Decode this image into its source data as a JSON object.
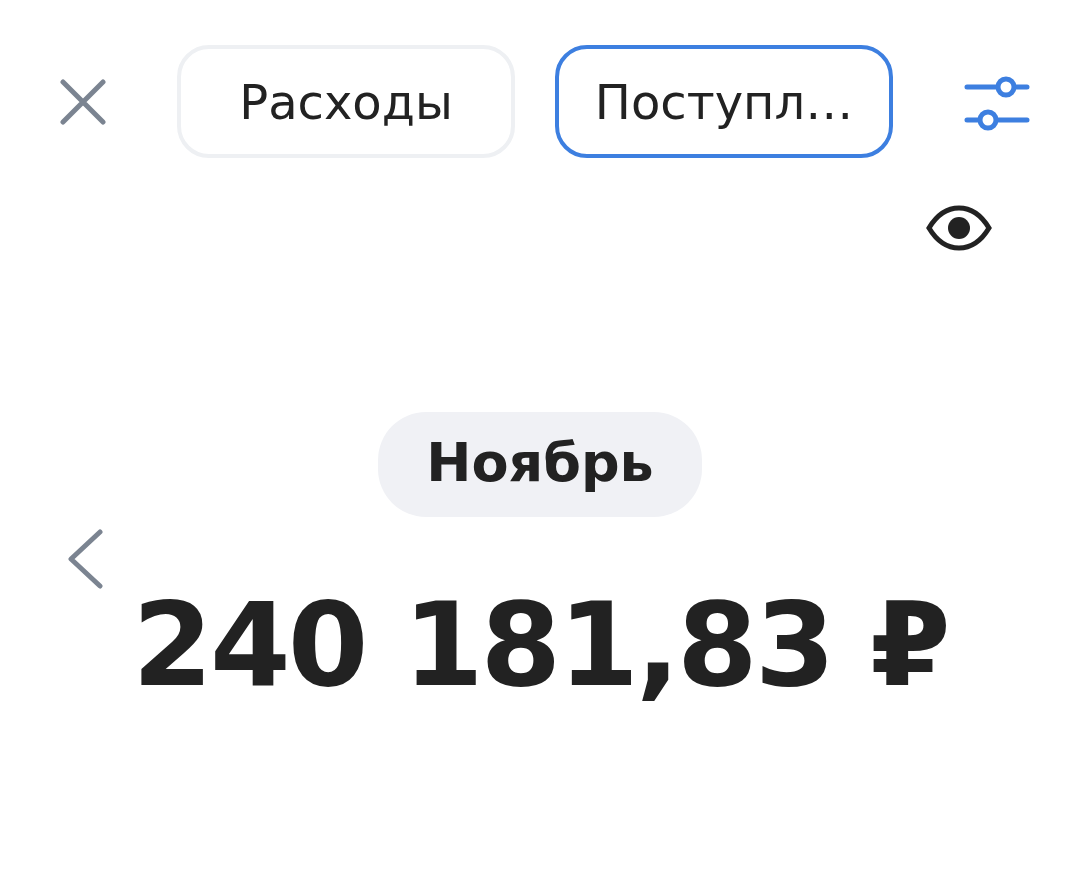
{
  "tabs": [
    {
      "label": "Расходы",
      "selected": false
    },
    {
      "label": "Поступл…",
      "selected": true
    }
  ],
  "period": {
    "label": "Ноябрь"
  },
  "total": {
    "amount": "240 181,83 ₽"
  }
}
